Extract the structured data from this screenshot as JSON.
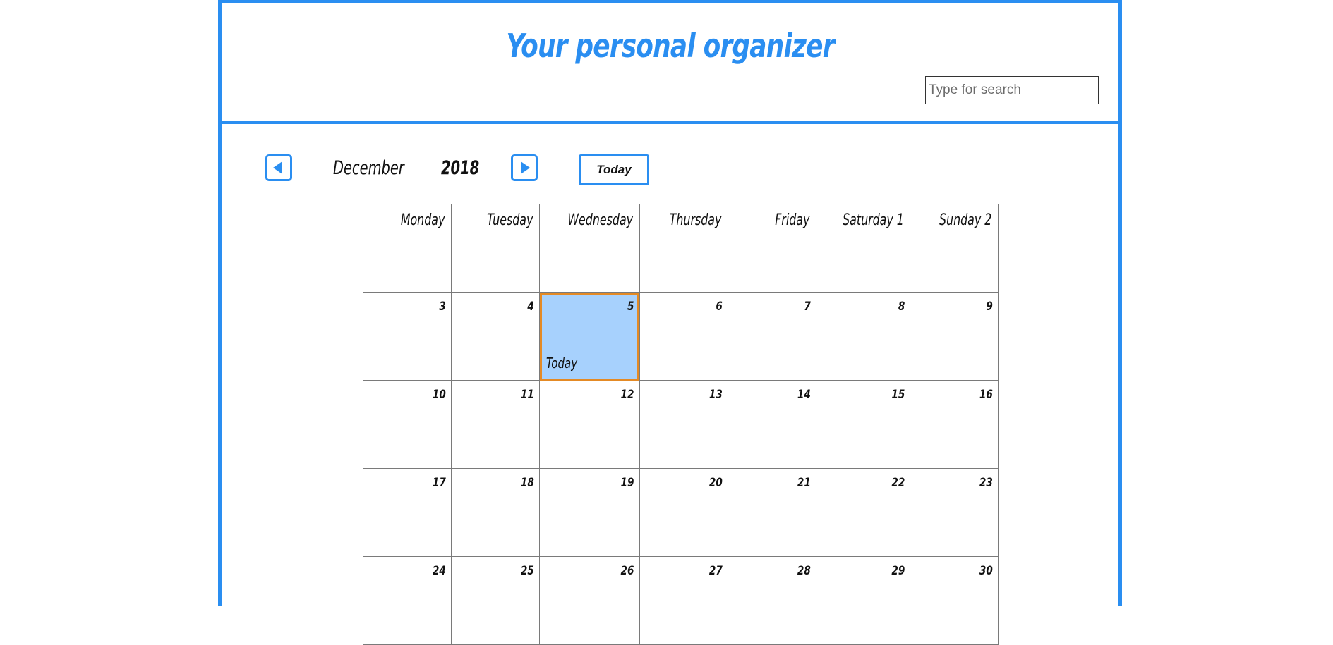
{
  "header": {
    "title": "Your personal organizer",
    "search_placeholder": "Type for search",
    "search_value": ""
  },
  "nav": {
    "prev_icon": "triangle-left-icon",
    "next_icon": "triangle-right-icon",
    "month": "December",
    "year": "2018",
    "today_label": "Today"
  },
  "calendar": {
    "weekdays": [
      "Monday",
      "Tuesday",
      "Wednesday",
      "Thursday",
      "Friday",
      "Saturday",
      "Sunday"
    ],
    "first_row_dates": [
      "",
      "",
      "",
      "",
      "",
      "1",
      "2"
    ],
    "weeks": [
      [
        "3",
        "4",
        "5",
        "6",
        "7",
        "8",
        "9"
      ],
      [
        "10",
        "11",
        "12",
        "13",
        "14",
        "15",
        "16"
      ],
      [
        "17",
        "18",
        "19",
        "20",
        "21",
        "22",
        "23"
      ],
      [
        "24",
        "25",
        "26",
        "27",
        "28",
        "29",
        "30"
      ]
    ],
    "today_date": "5",
    "today_marker": "Today"
  },
  "colors": {
    "accent": "#2a8ef1",
    "today_fill": "#a7d1fd",
    "today_border": "#e48a25"
  }
}
